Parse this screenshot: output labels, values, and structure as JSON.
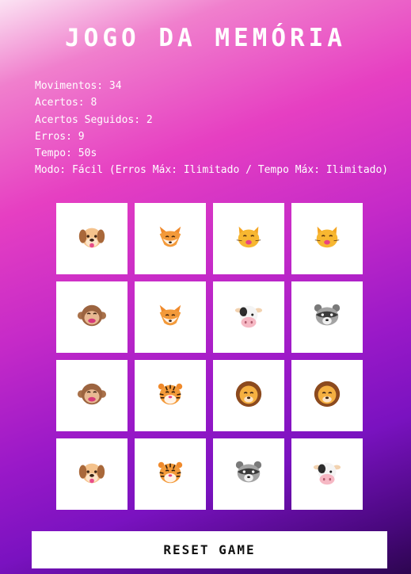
{
  "title": "JOGO DA MEMÓRIA",
  "stats": {
    "moves": "Movimentos: 34",
    "hits": "Acertos: 8",
    "streak": "Acertos Seguidos: 2",
    "errors": "Erros: 9",
    "time": "Tempo: 50s",
    "mode": "Modo: Fácil (Erros Máx: Ilimitado / Tempo Máx: Ilimitado)"
  },
  "cards": [
    {
      "animal": "dog"
    },
    {
      "animal": "fox"
    },
    {
      "animal": "cat"
    },
    {
      "animal": "cat"
    },
    {
      "animal": "monkey"
    },
    {
      "animal": "fox"
    },
    {
      "animal": "cow"
    },
    {
      "animal": "raccoon"
    },
    {
      "animal": "monkey"
    },
    {
      "animal": "tiger"
    },
    {
      "animal": "lion"
    },
    {
      "animal": "lion"
    },
    {
      "animal": "dog"
    },
    {
      "animal": "tiger"
    },
    {
      "animal": "raccoon"
    },
    {
      "animal": "cow"
    }
  ],
  "reset_label": "RESET GAME"
}
